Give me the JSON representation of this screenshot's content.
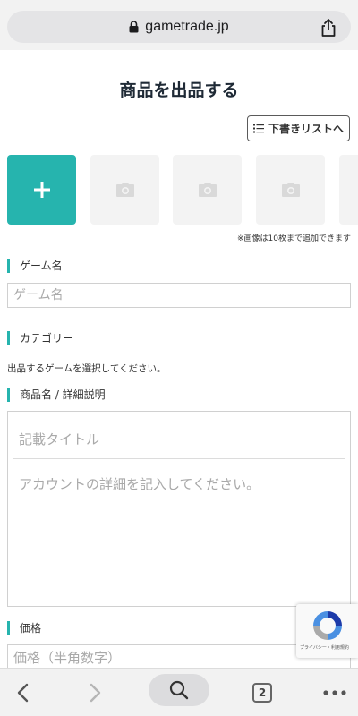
{
  "browser": {
    "url": "gametrade.jp",
    "lock_icon": "lock-icon",
    "share_icon": "share-icon"
  },
  "page": {
    "title": "商品を出品する",
    "draft_button": "下書きリストへ",
    "image_note": "※画像は10枚まで追加できます"
  },
  "form": {
    "game_name": {
      "label": "ゲーム名",
      "placeholder": "ゲーム名"
    },
    "category": {
      "label": "カテゴリー",
      "hint": "出品するゲームを選択してください。"
    },
    "description": {
      "label": "商品名 / 詳細説明",
      "title_placeholder": "記載タイトル",
      "body_placeholder": "アカウントの詳細を記入してください。"
    },
    "price": {
      "label": "価格",
      "placeholder": "価格（半角数字）"
    }
  },
  "recaptcha": {
    "text": "プライバシー・利用規約"
  },
  "bottom_nav": {
    "tab_count": "2"
  },
  "colors": {
    "accent": "#26b4ae",
    "title": "#1f2a36"
  }
}
